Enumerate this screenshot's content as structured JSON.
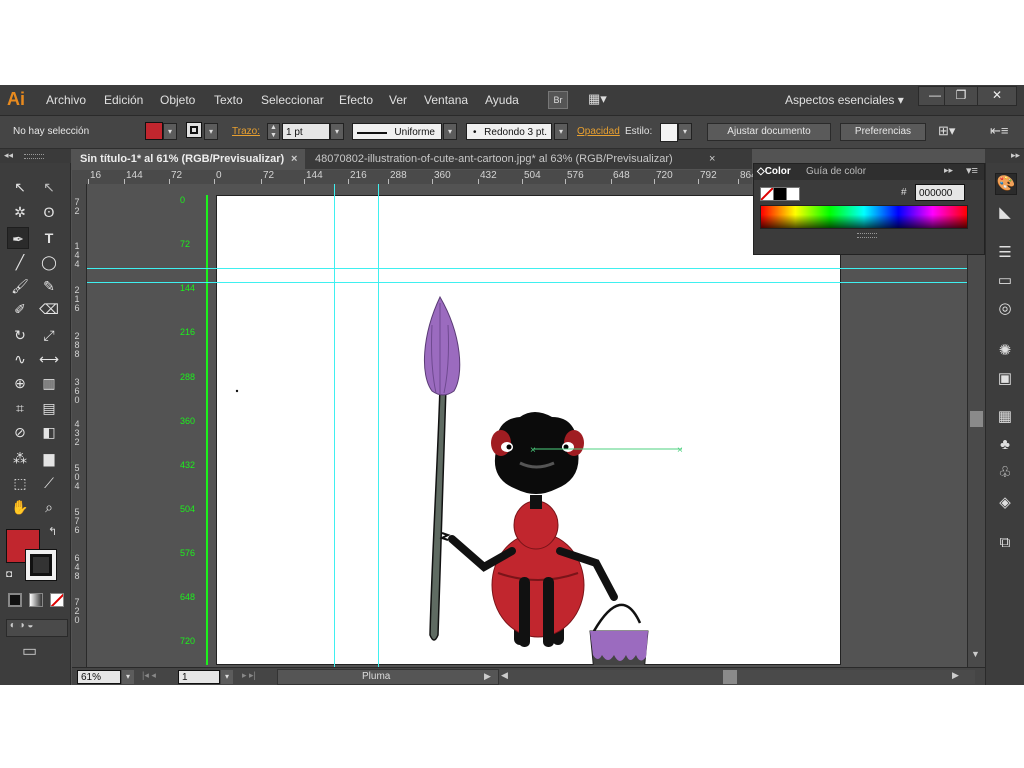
{
  "app": {
    "logo": "Ai"
  },
  "menu": [
    "Archivo",
    "Edición",
    "Objeto",
    "Texto",
    "Seleccionar",
    "Efecto",
    "Ver",
    "Ventana",
    "Ayuda"
  ],
  "menu_extras": {
    "br_label": "Br"
  },
  "workspace": {
    "label": "Aspectos esenciales",
    "arrow": "▾"
  },
  "window_controls": {
    "minimize": "—",
    "restore": "❐",
    "close": "✕"
  },
  "control": {
    "selection": "No hay selección",
    "stroke_label": "Trazo:",
    "stroke_value": "1 pt",
    "profile": "Uniforme",
    "brush": "Redondo 3 pt.",
    "opacity_label": "Opacidad",
    "style_label": "Estilo:",
    "adjust_button": "Ajustar documento",
    "prefs_button": "Preferencias",
    "fill_color": "#c1262e"
  },
  "tabs": [
    {
      "label": "Sin título-1* al 61% (RGB/Previsualizar)",
      "close": "×"
    },
    {
      "label": "48070802-illustration-of-cute-ant-cartoon.jpg* al 63% (RGB/Previsualizar)",
      "close": "×"
    }
  ],
  "ruler_top": [
    "16",
    "144",
    "72",
    "0",
    "72",
    "144",
    "216",
    "288",
    "360",
    "432",
    "504",
    "576",
    "648",
    "720",
    "792",
    "864"
  ],
  "ruler_left": [
    [
      "7",
      "2"
    ],
    [
      "1",
      "4",
      "4"
    ],
    [
      "2",
      "1",
      "6"
    ],
    [
      "2",
      "8",
      "8"
    ],
    [
      "3",
      "6",
      "0"
    ],
    [
      "4",
      "3",
      "2"
    ],
    [
      "5",
      "0",
      "4"
    ],
    [
      "5",
      "7",
      "6"
    ],
    [
      "6",
      "4",
      "8"
    ],
    [
      "7",
      "2",
      "0"
    ]
  ],
  "guide_numbers": [
    "0",
    "72",
    "144",
    "216",
    "288",
    "360",
    "432",
    "504",
    "576",
    "648",
    "720"
  ],
  "color_panel": {
    "tab_active": "Color",
    "tab_other": "Guía de color",
    "hex_label": "#",
    "hex_value": "000000"
  },
  "status": {
    "zoom": "61%",
    "page": "1",
    "tool": "Pluma"
  },
  "icons": {
    "selection": "↖",
    "direct": "↖",
    "magic": "✲",
    "lasso": "ʘ",
    "pen": "✒",
    "type": "T",
    "line": "╱",
    "ellipse": "◯",
    "brush": "🖌",
    "pencil": "✎",
    "blob": "✐",
    "eraser": "⌫",
    "rotate": "↻",
    "scale": "⤢",
    "warp": "∿",
    "width": "⟷",
    "shapebuilder": "⊕",
    "chart": "▥",
    "mesh": "⌗",
    "gradient": "▤",
    "eyedropper": "⊘",
    "blend": "◧",
    "symbol": "⁂",
    "graph": "▆",
    "artboard": "⬚",
    "slice": "⟋",
    "hand": "✋",
    "zoom": "⌕"
  },
  "dock_icons": [
    "🎨",
    "◣",
    "☰",
    "▭",
    "◎",
    "✺",
    "▣",
    "▦",
    "♣",
    "♧",
    "◈",
    "⧉"
  ]
}
